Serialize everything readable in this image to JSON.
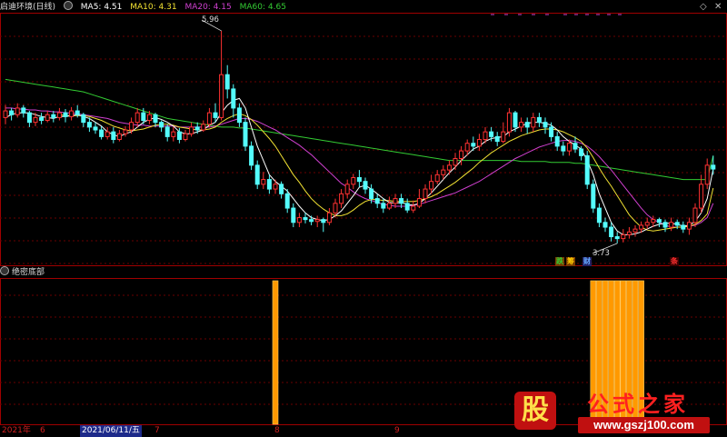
{
  "header": {
    "title": "启迪环境(日线)",
    "ma5": "MA5: 4.51",
    "ma10": "MA10: 4.31",
    "ma20": "MA20: 4.15",
    "ma60": "MA60: 4.65",
    "colors": {
      "ma5": "#ffffff",
      "ma10": "#f2e233",
      "ma20": "#d040d0",
      "ma60": "#33cc33"
    }
  },
  "annotations": {
    "high_label": "5.96",
    "low_label": "3.73",
    "signals": [
      {
        "text": "跌",
        "color": "#33cc33",
        "bg": "#7a3a00"
      },
      {
        "text": "筹",
        "color": "#ffcc00",
        "bg": "#7a3a00"
      },
      {
        "text": "财",
        "color": "#66aaff",
        "bg": "#222266"
      },
      {
        "text": "条",
        "color": "#ff3030",
        "bg": "#3a0000"
      }
    ]
  },
  "subpanel": {
    "title": "绝密底部"
  },
  "time_axis": {
    "year": "2021年",
    "labels": [
      "6",
      "2021/06/11/五",
      "7",
      "8",
      "9"
    ]
  },
  "window_controls": {
    "prev_icon": "◇",
    "close_icon": "✕"
  },
  "watermark": {
    "icon_text": "股",
    "name": "公式之家",
    "url": "www.gszj100.com"
  },
  "colors": {
    "up": "#ff3232",
    "down": "#54fcfc",
    "bar": "#ff9900",
    "grid": "#6a0000",
    "border": "#a00000"
  },
  "chart_data": {
    "type": "candlestick",
    "price_range": [
      3.5,
      6.15
    ],
    "candles": [
      [
        5.05,
        5.12,
        5.18,
        4.98
      ],
      [
        5.12,
        5.08,
        5.15,
        5.02
      ],
      [
        5.08,
        5.15,
        5.2,
        5.05
      ],
      [
        5.15,
        5.1,
        5.18,
        5.05
      ],
      [
        5.1,
        5.0,
        5.12,
        4.95
      ],
      [
        5.0,
        5.05,
        5.1,
        4.96
      ],
      [
        5.05,
        5.02,
        5.1,
        4.98
      ],
      [
        5.02,
        5.08,
        5.12,
        5.0
      ],
      [
        5.08,
        5.05,
        5.12,
        5.0
      ],
      [
        5.05,
        5.1,
        5.15,
        5.02
      ],
      [
        5.1,
        5.06,
        5.14,
        5.0
      ],
      [
        5.06,
        5.12,
        5.16,
        5.02
      ],
      [
        5.12,
        5.08,
        5.18,
        5.05
      ],
      [
        5.08,
        5.0,
        5.1,
        4.95
      ],
      [
        5.0,
        4.95,
        5.05,
        4.9
      ],
      [
        4.95,
        4.92,
        5.0,
        4.88
      ],
      [
        4.92,
        4.85,
        4.96,
        4.82
      ],
      [
        4.85,
        4.9,
        4.95,
        4.82
      ],
      [
        4.9,
        4.82,
        4.95,
        4.78
      ],
      [
        4.82,
        4.88,
        4.92,
        4.8
      ],
      [
        4.88,
        4.92,
        4.96,
        4.85
      ],
      [
        4.92,
        5.0,
        5.05,
        4.88
      ],
      [
        5.0,
        5.1,
        5.15,
        4.95
      ],
      [
        5.1,
        5.02,
        5.15,
        4.98
      ],
      [
        5.02,
        5.08,
        5.12,
        4.98
      ],
      [
        5.08,
        5.0,
        5.1,
        4.95
      ],
      [
        5.0,
        4.95,
        5.02,
        4.9
      ],
      [
        4.95,
        4.85,
        4.98,
        4.8
      ],
      [
        4.85,
        4.9,
        4.95,
        4.8
      ],
      [
        4.9,
        4.82,
        4.94,
        4.78
      ],
      [
        4.82,
        4.88,
        4.92,
        4.8
      ],
      [
        4.88,
        4.95,
        5.0,
        4.85
      ],
      [
        4.95,
        4.92,
        5.0,
        4.88
      ],
      [
        4.92,
        4.98,
        5.02,
        4.9
      ],
      [
        4.98,
        5.1,
        5.15,
        4.95
      ],
      [
        5.1,
        5.05,
        5.2,
        5.0
      ],
      [
        5.05,
        5.5,
        5.96,
        5.02
      ],
      [
        5.5,
        5.35,
        5.6,
        5.25
      ],
      [
        5.35,
        5.15,
        5.4,
        5.05
      ],
      [
        5.15,
        5.0,
        5.2,
        4.95
      ],
      [
        5.0,
        4.75,
        5.05,
        4.7
      ],
      [
        4.75,
        4.55,
        4.8,
        4.5
      ],
      [
        4.55,
        4.35,
        4.6,
        4.3
      ],
      [
        4.35,
        4.4,
        4.48,
        4.3
      ],
      [
        4.4,
        4.3,
        4.45,
        4.25
      ],
      [
        4.3,
        4.35,
        4.4,
        4.25
      ],
      [
        4.35,
        4.25,
        4.38,
        4.2
      ],
      [
        4.25,
        4.1,
        4.3,
        4.05
      ],
      [
        4.1,
        3.95,
        4.15,
        3.9
      ],
      [
        3.95,
        4.0,
        4.05,
        3.9
      ],
      [
        4.0,
        3.98,
        4.05,
        3.94
      ],
      [
        3.98,
        3.96,
        4.02,
        3.92
      ],
      [
        3.96,
        3.98,
        4.02,
        3.9
      ],
      [
        3.98,
        3.95,
        4.0,
        3.85
      ],
      [
        3.95,
        4.05,
        4.1,
        3.92
      ],
      [
        4.05,
        4.15,
        4.2,
        4.0
      ],
      [
        4.15,
        4.25,
        4.3,
        4.1
      ],
      [
        4.25,
        4.35,
        4.4,
        4.2
      ],
      [
        4.35,
        4.42,
        4.46,
        4.3
      ],
      [
        4.42,
        4.38,
        4.5,
        4.32
      ],
      [
        4.38,
        4.3,
        4.42,
        4.25
      ],
      [
        4.3,
        4.2,
        4.35,
        4.15
      ],
      [
        4.2,
        4.15,
        4.25,
        4.1
      ],
      [
        4.15,
        4.1,
        4.2,
        4.05
      ],
      [
        4.1,
        4.15,
        4.22,
        4.08
      ],
      [
        4.15,
        4.2,
        4.25,
        4.1
      ],
      [
        4.2,
        4.15,
        4.25,
        4.1
      ],
      [
        4.15,
        4.08,
        4.2,
        4.05
      ],
      [
        4.08,
        4.12,
        4.18,
        4.05
      ],
      [
        4.12,
        4.2,
        4.3,
        4.1
      ],
      [
        4.2,
        4.3,
        4.35,
        4.15
      ],
      [
        4.3,
        4.38,
        4.45,
        4.25
      ],
      [
        4.38,
        4.45,
        4.5,
        4.35
      ],
      [
        4.45,
        4.5,
        4.55,
        4.4
      ],
      [
        4.5,
        4.55,
        4.6,
        4.45
      ],
      [
        4.55,
        4.62,
        4.68,
        4.5
      ],
      [
        4.62,
        4.7,
        4.75,
        4.55
      ],
      [
        4.7,
        4.78,
        4.82,
        4.65
      ],
      [
        4.78,
        4.75,
        4.85,
        4.7
      ],
      [
        4.75,
        4.82,
        4.88,
        4.7
      ],
      [
        4.82,
        4.9,
        4.95,
        4.78
      ],
      [
        4.9,
        4.85,
        4.95,
        4.8
      ],
      [
        4.85,
        4.8,
        4.9,
        4.75
      ],
      [
        4.8,
        4.9,
        5.0,
        4.78
      ],
      [
        4.9,
        5.1,
        5.15,
        4.85
      ],
      [
        5.1,
        4.95,
        5.12,
        4.9
      ],
      [
        4.95,
        5.0,
        5.05,
        4.9
      ],
      [
        5.0,
        4.95,
        5.05,
        4.88
      ],
      [
        4.95,
        5.05,
        5.1,
        4.9
      ],
      [
        5.05,
        5.0,
        5.1,
        4.95
      ],
      [
        5.0,
        4.95,
        5.05,
        4.88
      ],
      [
        4.95,
        4.85,
        5.0,
        4.8
      ],
      [
        4.85,
        4.75,
        4.9,
        4.7
      ],
      [
        4.75,
        4.7,
        4.8,
        4.65
      ],
      [
        4.7,
        4.78,
        4.82,
        4.65
      ],
      [
        4.78,
        4.72,
        4.85,
        4.68
      ],
      [
        4.72,
        4.65,
        4.75,
        4.6
      ],
      [
        4.65,
        4.35,
        4.7,
        4.3
      ],
      [
        4.35,
        4.1,
        4.4,
        4.05
      ],
      [
        4.1,
        3.95,
        4.15,
        3.9
      ],
      [
        3.95,
        3.9,
        4.0,
        3.85
      ],
      [
        3.9,
        3.8,
        3.95,
        3.75
      ],
      [
        3.8,
        3.78,
        3.85,
        3.73
      ],
      [
        3.78,
        3.82,
        3.88,
        3.74
      ],
      [
        3.82,
        3.85,
        3.9,
        3.78
      ],
      [
        3.85,
        3.88,
        3.92,
        3.8
      ],
      [
        3.88,
        3.92,
        3.96,
        3.84
      ],
      [
        3.92,
        3.95,
        4.0,
        3.88
      ],
      [
        3.95,
        3.98,
        4.02,
        3.9
      ],
      [
        3.98,
        3.95,
        4.0,
        3.9
      ],
      [
        3.95,
        3.9,
        3.98,
        3.85
      ],
      [
        3.9,
        3.95,
        4.0,
        3.86
      ],
      [
        3.95,
        3.92,
        3.98,
        3.88
      ],
      [
        3.92,
        3.88,
        3.96,
        3.84
      ],
      [
        3.88,
        3.95,
        4.0,
        3.82
      ],
      [
        3.95,
        4.1,
        4.15,
        3.9
      ],
      [
        4.1,
        4.35,
        4.45,
        4.05
      ],
      [
        4.35,
        4.55,
        4.62,
        4.3
      ],
      [
        4.55,
        4.51,
        4.65,
        4.45
      ]
    ],
    "ma5": [
      5.05,
      5.08,
      5.1,
      5.1,
      5.1,
      5.08,
      5.06,
      5.05,
      5.04,
      5.06,
      5.06,
      5.07,
      5.08,
      5.06,
      5.04,
      5.0,
      4.96,
      4.9,
      4.87,
      4.85,
      4.88,
      4.9,
      4.95,
      5.0,
      5.03,
      5.05,
      5.03,
      5.0,
      4.96,
      4.9,
      4.88,
      4.88,
      4.9,
      4.92,
      4.97,
      5.0,
      5.1,
      5.18,
      5.23,
      5.25,
      5.15,
      4.95,
      4.75,
      4.6,
      4.45,
      4.38,
      4.33,
      4.28,
      4.2,
      4.12,
      4.05,
      4.0,
      3.98,
      3.97,
      3.98,
      4.02,
      4.07,
      4.15,
      4.23,
      4.32,
      4.34,
      4.3,
      4.25,
      4.2,
      4.16,
      4.15,
      4.16,
      4.14,
      4.13,
      4.15,
      4.2,
      4.26,
      4.33,
      4.4,
      4.47,
      4.53,
      4.6,
      4.66,
      4.72,
      4.75,
      4.8,
      4.83,
      4.84,
      4.85,
      4.9,
      4.93,
      4.96,
      4.99,
      5.0,
      5.0,
      4.99,
      4.97,
      4.92,
      4.85,
      4.8,
      4.76,
      4.72,
      4.6,
      4.45,
      4.25,
      4.1,
      3.95,
      3.86,
      3.82,
      3.82,
      3.83,
      3.85,
      3.88,
      3.91,
      3.93,
      3.94,
      3.94,
      3.93,
      3.91,
      3.92,
      3.96,
      4.05,
      4.2,
      4.51
    ],
    "ma10": [
      null,
      null,
      null,
      null,
      null,
      null,
      null,
      null,
      null,
      5.08,
      5.07,
      5.07,
      5.07,
      5.07,
      5.06,
      5.04,
      5.02,
      4.99,
      4.96,
      4.94,
      4.92,
      4.91,
      4.92,
      4.93,
      4.95,
      4.97,
      4.98,
      4.98,
      4.97,
      4.95,
      4.94,
      4.93,
      4.92,
      4.92,
      4.93,
      4.95,
      5.0,
      5.04,
      5.07,
      5.09,
      5.07,
      5.03,
      4.97,
      4.9,
      4.83,
      4.75,
      4.65,
      4.55,
      4.45,
      4.37,
      4.28,
      4.2,
      4.14,
      4.09,
      4.05,
      4.02,
      4.02,
      4.04,
      4.08,
      4.13,
      4.17,
      4.19,
      4.19,
      4.18,
      4.18,
      4.17,
      4.17,
      4.17,
      4.17,
      4.18,
      4.2,
      4.22,
      4.25,
      4.29,
      4.33,
      4.37,
      4.42,
      4.47,
      4.52,
      4.58,
      4.63,
      4.68,
      4.72,
      4.76,
      4.8,
      4.83,
      4.86,
      4.88,
      4.9,
      4.92,
      4.93,
      4.93,
      4.92,
      4.9,
      4.87,
      4.84,
      4.8,
      4.73,
      4.63,
      4.52,
      4.42,
      4.33,
      4.23,
      4.13,
      4.03,
      3.96,
      3.9,
      3.87,
      3.86,
      3.87,
      3.88,
      3.89,
      3.9,
      3.9,
      3.91,
      3.93,
      3.97,
      4.04,
      4.31
    ],
    "ma20": [
      5.15,
      5.15,
      5.14,
      5.14,
      5.13,
      5.13,
      5.12,
      5.12,
      5.11,
      5.11,
      5.1,
      5.1,
      5.09,
      5.08,
      5.07,
      5.06,
      5.05,
      5.04,
      5.02,
      5.0,
      4.99,
      4.98,
      4.97,
      4.97,
      4.96,
      4.96,
      4.96,
      4.96,
      4.96,
      4.95,
      4.95,
      4.95,
      4.95,
      4.95,
      4.95,
      4.96,
      4.98,
      5.0,
      5.02,
      5.04,
      5.04,
      5.03,
      5.01,
      4.98,
      4.95,
      4.92,
      4.88,
      4.84,
      4.8,
      4.76,
      4.71,
      4.66,
      4.6,
      4.54,
      4.48,
      4.42,
      4.36,
      4.32,
      4.27,
      4.23,
      4.2,
      4.18,
      4.16,
      4.14,
      4.13,
      4.12,
      4.12,
      4.12,
      4.13,
      4.14,
      4.16,
      4.18,
      4.2,
      4.22,
      4.24,
      4.26,
      4.29,
      4.32,
      4.35,
      4.38,
      4.42,
      4.46,
      4.5,
      4.54,
      4.58,
      4.62,
      4.65,
      4.68,
      4.71,
      4.74,
      4.76,
      4.78,
      4.8,
      4.81,
      4.81,
      4.8,
      4.78,
      4.75,
      4.7,
      4.64,
      4.57,
      4.5,
      4.42,
      4.34,
      4.26,
      4.18,
      4.1,
      4.03,
      3.98,
      3.95,
      3.92,
      3.9,
      3.9,
      3.9,
      3.91,
      3.92,
      3.95,
      4.0,
      4.15
    ],
    "ma60": [
      5.45,
      5.44,
      5.43,
      5.42,
      5.41,
      5.4,
      5.39,
      5.38,
      5.37,
      5.36,
      5.35,
      5.34,
      5.33,
      5.32,
      5.3,
      5.28,
      5.26,
      5.24,
      5.22,
      5.2,
      5.18,
      5.16,
      5.14,
      5.12,
      5.1,
      5.08,
      5.06,
      5.04,
      5.03,
      5.02,
      5.01,
      5.0,
      4.99,
      4.98,
      4.97,
      4.96,
      4.95,
      4.95,
      4.95,
      4.94,
      4.94,
      4.93,
      4.92,
      4.91,
      4.9,
      4.89,
      4.88,
      4.87,
      4.86,
      4.85,
      4.84,
      4.83,
      4.82,
      4.81,
      4.8,
      4.79,
      4.78,
      4.77,
      4.76,
      4.75,
      4.74,
      4.73,
      4.72,
      4.71,
      4.7,
      4.69,
      4.68,
      4.67,
      4.66,
      4.65,
      4.64,
      4.63,
      4.62,
      4.61,
      4.6,
      4.6,
      4.6,
      4.6,
      4.6,
      4.6,
      4.6,
      4.6,
      4.6,
      4.6,
      4.6,
      4.6,
      4.59,
      4.59,
      4.59,
      4.59,
      4.59,
      4.58,
      4.58,
      4.58,
      4.58,
      4.57,
      4.57,
      4.56,
      4.55,
      4.54,
      4.53,
      4.52,
      4.51,
      4.5,
      4.49,
      4.48,
      4.47,
      4.46,
      4.45,
      4.44,
      4.43,
      4.42,
      4.41,
      4.4,
      4.4,
      4.4,
      4.4,
      4.4,
      4.65
    ],
    "bottom_signal_bars": [
      45,
      98,
      99,
      100,
      101,
      102,
      103,
      104,
      105,
      106
    ]
  }
}
